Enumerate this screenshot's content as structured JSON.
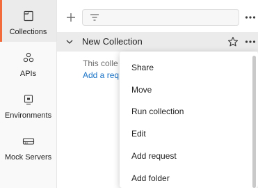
{
  "sidebar": {
    "items": [
      {
        "label": "Collections",
        "icon": "collections-icon",
        "active": true
      },
      {
        "label": "APIs",
        "icon": "apis-icon",
        "active": false
      },
      {
        "label": "Environments",
        "icon": "environments-icon",
        "active": false
      },
      {
        "label": "Mock Servers",
        "icon": "mock-servers-icon",
        "active": false
      }
    ]
  },
  "toolbar": {
    "new_icon": "plus-icon",
    "filter_icon": "filter-icon",
    "filter_value": "",
    "more_icon": "more-horizontal-icon"
  },
  "collection": {
    "name": "New Collection",
    "empty_text": "This colle",
    "add_link": "Add a req"
  },
  "context_menu": {
    "items": [
      "Share",
      "Move",
      "Run collection",
      "Edit",
      "Add request",
      "Add folder"
    ]
  },
  "colors": {
    "accent": "#f26b3a",
    "link": "#1a73c7",
    "active_bg": "#ebebeb"
  }
}
